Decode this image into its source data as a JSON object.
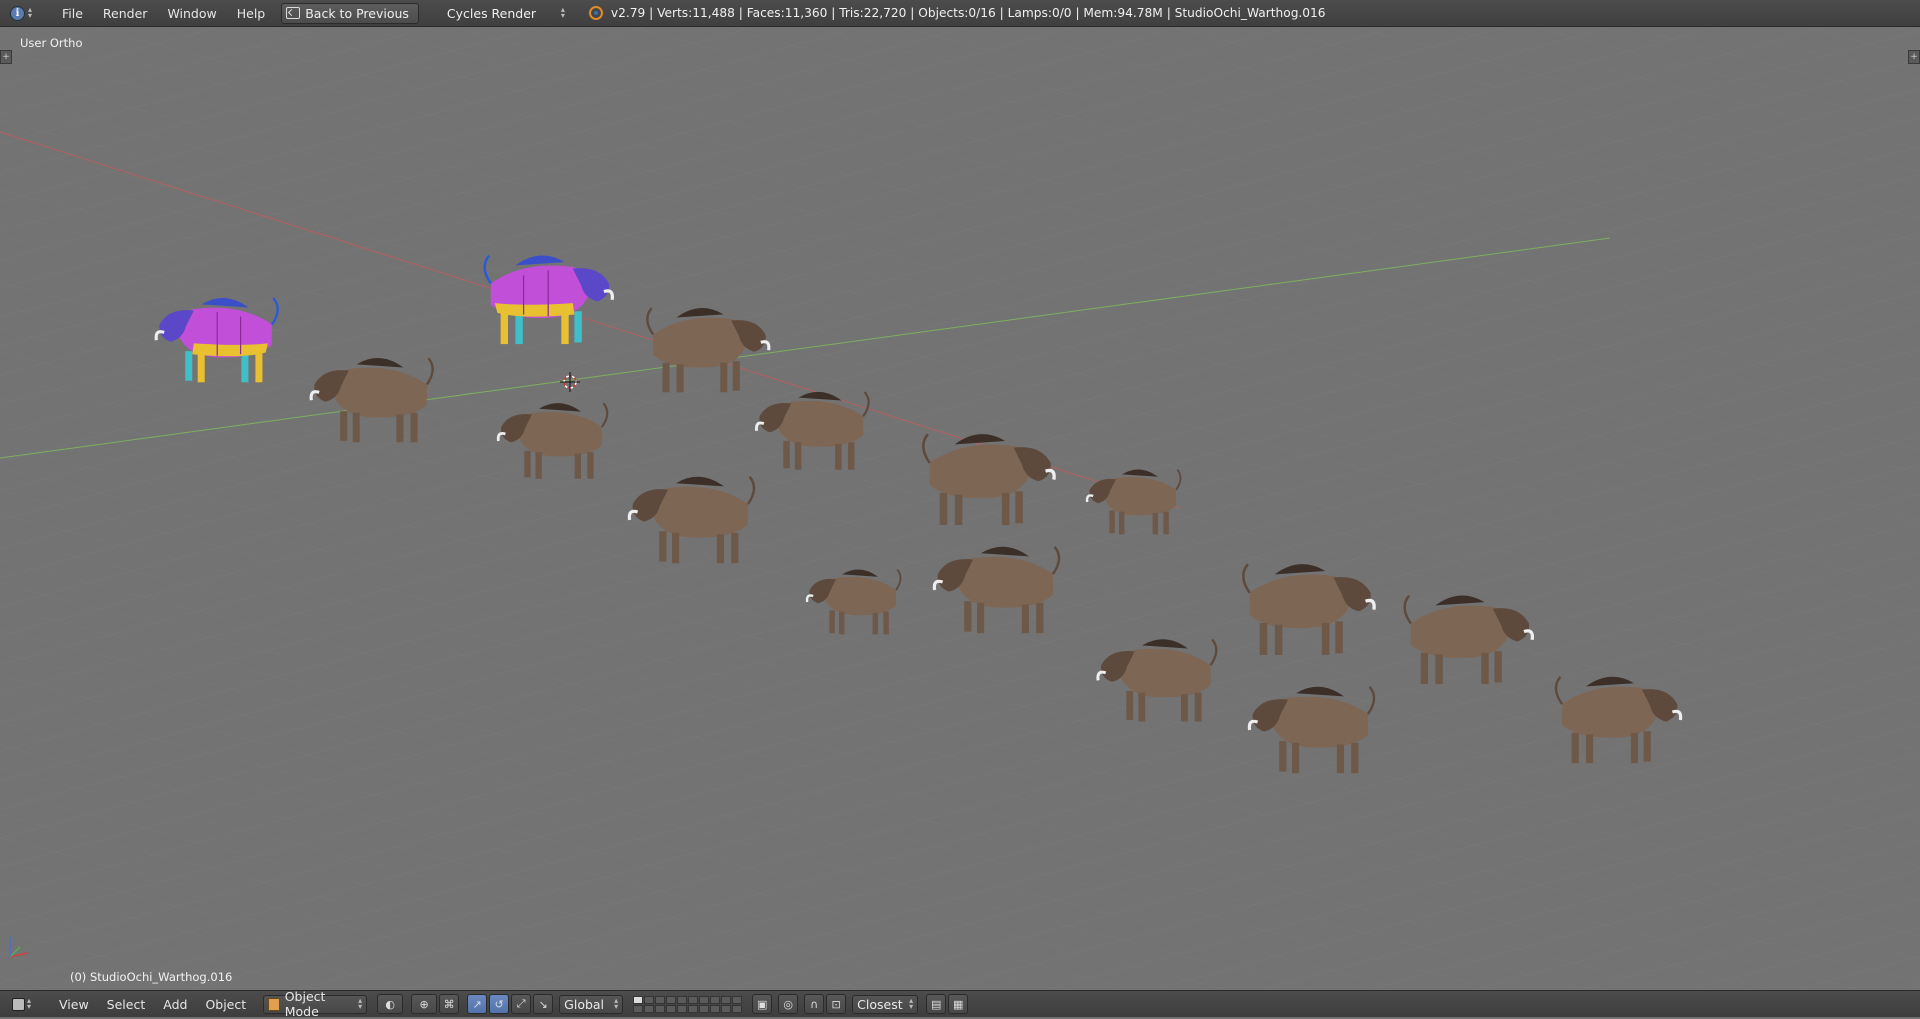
{
  "topbar": {
    "menu": [
      "File",
      "Render",
      "Window",
      "Help"
    ],
    "back_button": "Back to Previous",
    "render_engine": "Cycles Render",
    "stats": "v2.79 | Verts:11,488 | Faces:11,360 | Tris:22,720 | Objects:0/16 | Lamps:0/0 | Mem:94.78M | StudioOchi_Warthog.016"
  },
  "viewport": {
    "view_label": "User Ortho",
    "object_label": "(0) StudioOchi_Warthog.016",
    "background_color": "#737373",
    "x_axis_color": "#c85a5a",
    "y_axis_color": "#7fbf5a"
  },
  "bottombar": {
    "menu": [
      "View",
      "Select",
      "Add",
      "Object"
    ],
    "mode": "Object Mode",
    "orientation": "Global",
    "snap_target": "Closest"
  }
}
